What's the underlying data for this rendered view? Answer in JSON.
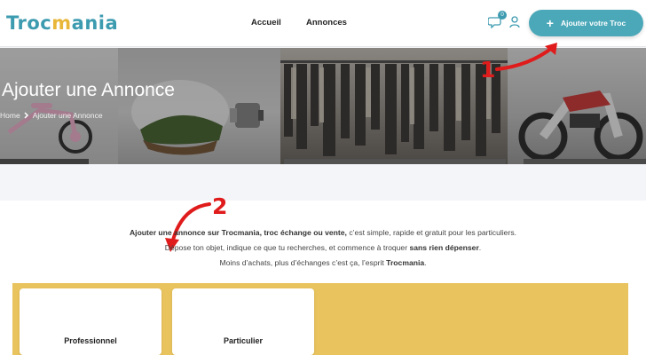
{
  "header": {
    "logo": {
      "part1": "Troc",
      "part2": "m",
      "part3": "a",
      "part4": "nia"
    },
    "nav": [
      {
        "label": "Accueil"
      },
      {
        "label": "Annonces"
      }
    ],
    "notification_count": "0",
    "add_button_label": "Ajouter votre Troc",
    "colors": {
      "brand": "#3d9bb0",
      "button": "#4aa8b9",
      "logo_accent": "#e8b73a"
    }
  },
  "hero": {
    "title": "Ajouter une Annonce",
    "breadcrumb": [
      "Home",
      "Ajouter une Annonce"
    ]
  },
  "annotations": {
    "step1": "1",
    "step2": "2",
    "color": "#e01b1b"
  },
  "intro": {
    "line1_a": "Ajouter une annonce ",
    "line1_b": "sur Trocmania, troc échange ou vente,",
    "line1_c": " c’est simple, rapide et gratuit pour les particuliers.",
    "line2_a": "Dépose ton objet, indique ce que tu recherches, et commence à troquer ",
    "line2_b": "sans rien dépenser",
    "line2_c": ".",
    "line3_a": "Moins d’achats, plus d’échanges c’est ça, l’esprit ",
    "line3_b": "Trocmania",
    "line3_c": "."
  },
  "cards": [
    {
      "label": "Professionnel"
    },
    {
      "label": "Particulier"
    }
  ],
  "panel_color": "#e9c35e"
}
